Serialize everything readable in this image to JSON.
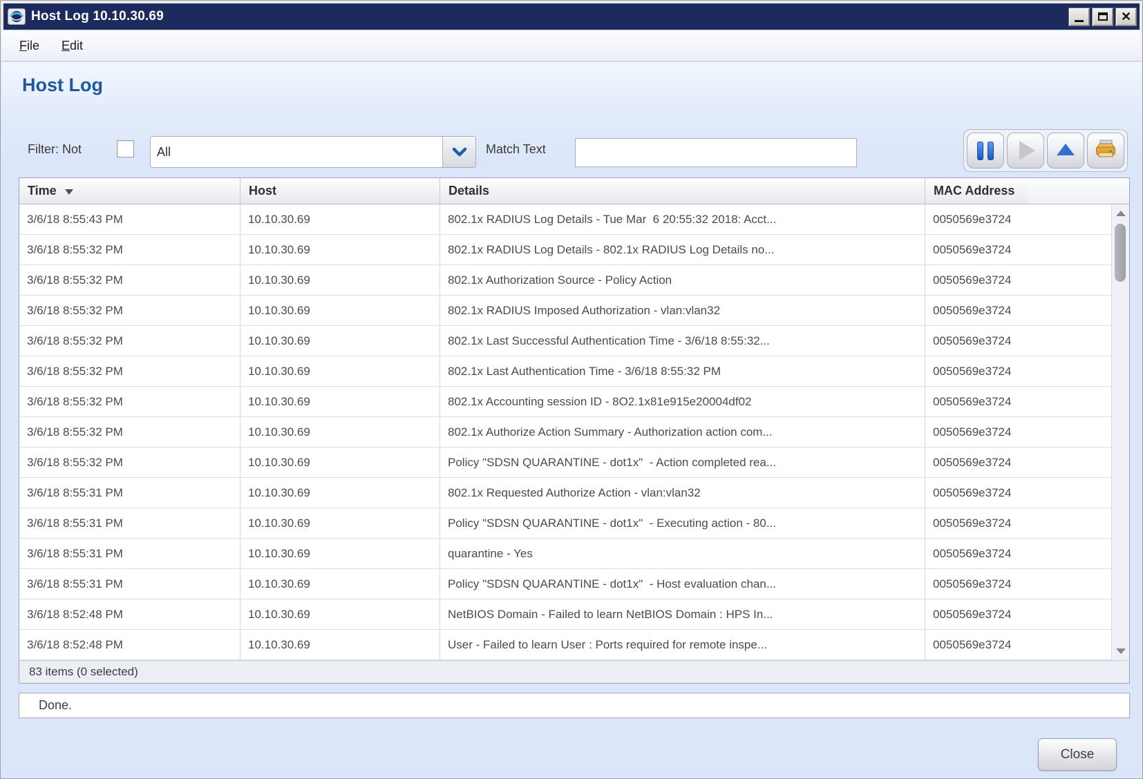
{
  "window": {
    "title": "Host Log 10.10.30.69"
  },
  "menubar": {
    "items": [
      {
        "label": "File"
      },
      {
        "label": "Edit"
      }
    ]
  },
  "page": {
    "heading": "Host Log"
  },
  "filter": {
    "label": "Filter: Not",
    "not_checked": false,
    "dropdown_value": "All",
    "match_text_label": "Match Text",
    "match_text_value": ""
  },
  "toolbar": {
    "buttons": [
      {
        "name": "pause",
        "icon": "pause-icon",
        "enabled": true
      },
      {
        "name": "resume",
        "icon": "play-icon",
        "enabled": false
      },
      {
        "name": "scroll-to-top",
        "icon": "arrow-up-icon",
        "enabled": true
      },
      {
        "name": "print",
        "icon": "printer-icon",
        "enabled": true
      }
    ]
  },
  "icons": {
    "app": "counteract-logo",
    "minimize": "minimize",
    "maximize": "maximize",
    "close": "x",
    "combo": "chevron-down",
    "sort": "triangle-down"
  },
  "table": {
    "columns": [
      {
        "label": "Time",
        "sorted": "desc"
      },
      {
        "label": "Host"
      },
      {
        "label": "Details"
      },
      {
        "label": "MAC Address"
      }
    ],
    "rows": [
      {
        "time": "3/6/18 8:55:43 PM",
        "host": "10.10.30.69",
        "details": "802.1x RADIUS Log Details - Tue Mar  6 20:55:32 2018: Acct...",
        "mac": "0050569e3724"
      },
      {
        "time": "3/6/18 8:55:32 PM",
        "host": "10.10.30.69",
        "details": "802.1x RADIUS Log Details - 802.1x RADIUS Log Details no...",
        "mac": "0050569e3724"
      },
      {
        "time": "3/6/18 8:55:32 PM",
        "host": "10.10.30.69",
        "details": "802.1x Authorization Source - Policy Action",
        "mac": "0050569e3724"
      },
      {
        "time": "3/6/18 8:55:32 PM",
        "host": "10.10.30.69",
        "details": "802.1x RADIUS Imposed Authorization - vlan:vlan32",
        "mac": "0050569e3724"
      },
      {
        "time": "3/6/18 8:55:32 PM",
        "host": "10.10.30.69",
        "details": "802.1x Last Successful Authentication Time - 3/6/18 8:55:32...",
        "mac": "0050569e3724"
      },
      {
        "time": "3/6/18 8:55:32 PM",
        "host": "10.10.30.69",
        "details": "802.1x Last Authentication Time - 3/6/18 8:55:32 PM",
        "mac": "0050569e3724"
      },
      {
        "time": "3/6/18 8:55:32 PM",
        "host": "10.10.30.69",
        "details": "802.1x Accounting session ID - 8O2.1x81e915e20004df02",
        "mac": "0050569e3724"
      },
      {
        "time": "3/6/18 8:55:32 PM",
        "host": "10.10.30.69",
        "details": "802.1x Authorize Action Summary - Authorization action com...",
        "mac": "0050569e3724"
      },
      {
        "time": "3/6/18 8:55:32 PM",
        "host": "10.10.30.69",
        "details": "Policy \"SDSN QUARANTINE - dot1x\"  - Action completed rea...",
        "mac": "0050569e3724"
      },
      {
        "time": "3/6/18 8:55:31 PM",
        "host": "10.10.30.69",
        "details": "802.1x Requested Authorize Action - vlan:vlan32",
        "mac": "0050569e3724"
      },
      {
        "time": "3/6/18 8:55:31 PM",
        "host": "10.10.30.69",
        "details": "Policy \"SDSN QUARANTINE - dot1x\"  - Executing action - 80...",
        "mac": "0050569e3724"
      },
      {
        "time": "3/6/18 8:55:31 PM",
        "host": "10.10.30.69",
        "details": "quarantine - Yes",
        "mac": "0050569e3724"
      },
      {
        "time": "3/6/18 8:55:31 PM",
        "host": "10.10.30.69",
        "details": "Policy \"SDSN QUARANTINE - dot1x\"  - Host evaluation chan...",
        "mac": "0050569e3724"
      },
      {
        "time": "3/6/18 8:52:48 PM",
        "host": "10.10.30.69",
        "details": "NetBIOS Domain - Failed to learn NetBIOS Domain : HPS In...",
        "mac": "0050569e3724"
      },
      {
        "time": "3/6/18 8:52:48 PM",
        "host": "10.10.30.69",
        "details": "User - Failed to learn User : Ports required for remote inspe...",
        "mac": "0050569e3724"
      }
    ],
    "summary": "83 items (0 selected)"
  },
  "status": {
    "message": "Done."
  },
  "footer": {
    "close_label": "Close"
  },
  "colors": {
    "titlebar_bg": "#1c2a5e",
    "content_bg": "#dce6fa",
    "heading_text": "#1d5a9b",
    "accent_blue": "#2f6fd4",
    "table_text": "#4b4b4b"
  }
}
